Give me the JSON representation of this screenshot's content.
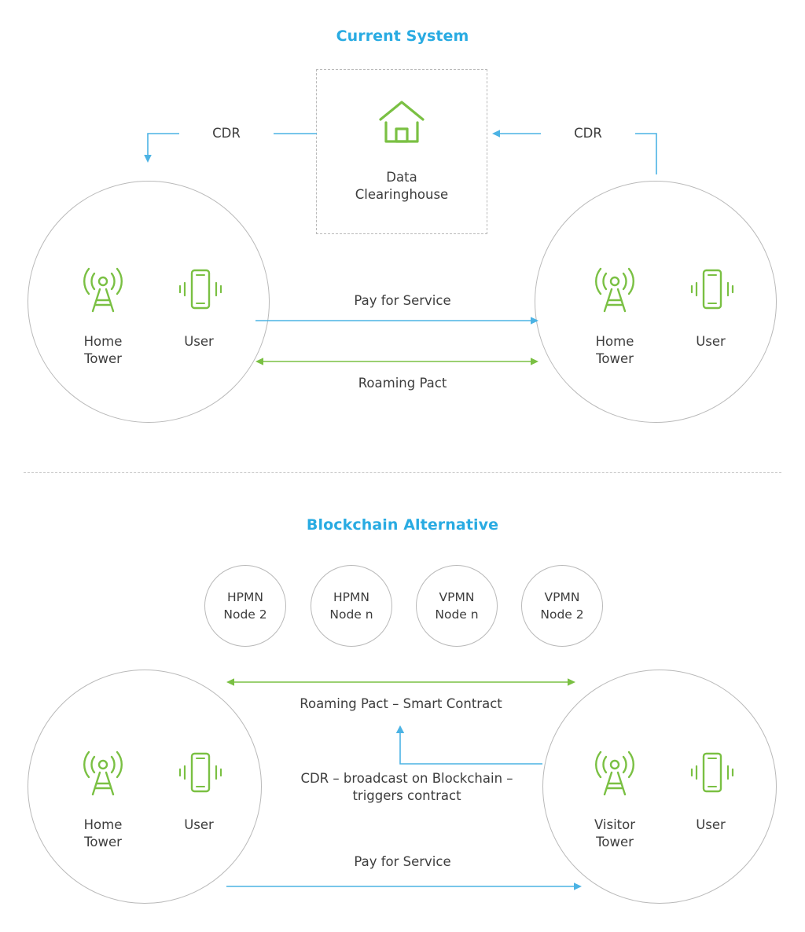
{
  "sections": {
    "current": {
      "title": "Current System",
      "clearinghouse": {
        "icon": "house-icon",
        "label_line1": "Data",
        "label_line2": "Clearinghouse"
      },
      "left_circle": {
        "tower_icon": "cell-tower-icon",
        "tower_label_line1": "Home",
        "tower_label_line2": "Tower",
        "phone_icon": "mobile-phone-icon",
        "phone_label": "User"
      },
      "right_circle": {
        "tower_icon": "cell-tower-icon",
        "tower_label_line1": "Home",
        "tower_label_line2": "Tower",
        "phone_icon": "mobile-phone-icon",
        "phone_label": "User"
      },
      "arrows": {
        "cdr_left": "CDR",
        "cdr_right": "CDR",
        "pay_for_service": "Pay for Service",
        "roaming_pact": "Roaming Pact"
      }
    },
    "blockchain": {
      "title": "Blockchain Alternative",
      "nodes": [
        {
          "line1": "HPMN",
          "line2": "Node 2"
        },
        {
          "line1": "HPMN",
          "line2": "Node n"
        },
        {
          "line1": "VPMN",
          "line2": "Node n"
        },
        {
          "line1": "VPMN",
          "line2": "Node 2"
        }
      ],
      "left_circle": {
        "tower_icon": "cell-tower-icon",
        "tower_label_line1": "Home",
        "tower_label_line2": "Tower",
        "phone_icon": "mobile-phone-icon",
        "phone_label": "User"
      },
      "right_circle": {
        "tower_icon": "cell-tower-icon",
        "tower_label_line1": "Visitor",
        "tower_label_line2": "Tower",
        "phone_icon": "mobile-phone-icon",
        "phone_label": "User"
      },
      "arrows": {
        "roaming_pact": "Roaming Pact – Smart Contract",
        "cdr_line1": "CDR – broadcast on Blockchain –",
        "cdr_line2": "triggers contract",
        "pay_for_service": "Pay for Service"
      }
    }
  },
  "colors": {
    "title_blue": "#29abe2",
    "arrow_blue": "#4cb3e4",
    "green": "#7ac043",
    "icon_green": "#7ac043",
    "outline_gray": "#b9b9b9",
    "text": "#3d3d3d"
  }
}
